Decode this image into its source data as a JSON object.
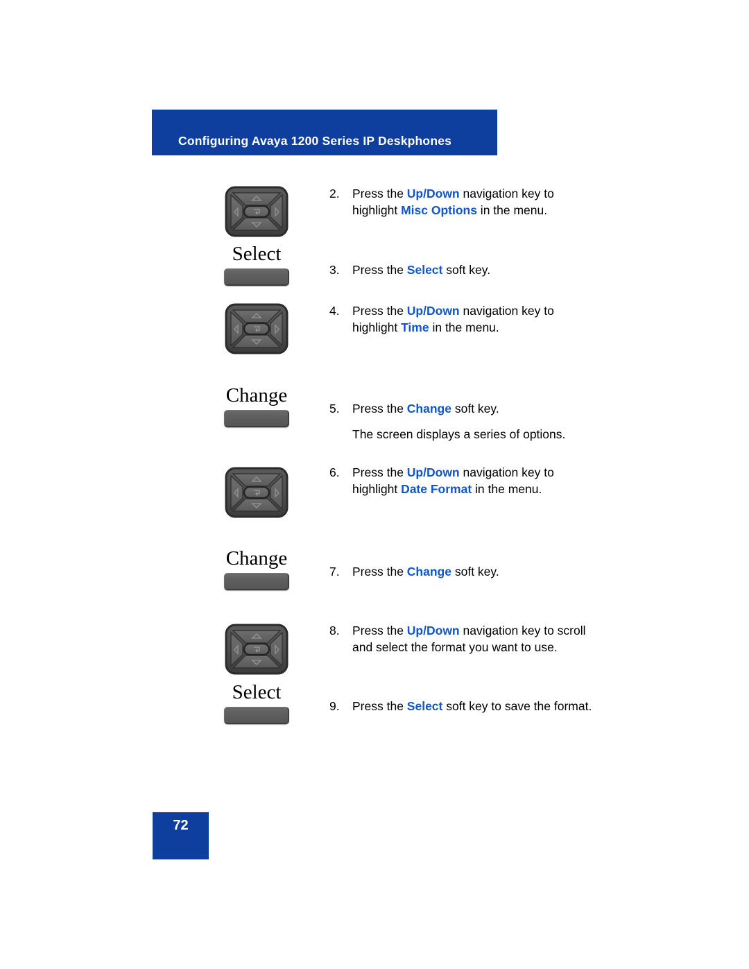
{
  "header": {
    "title": "Configuring Avaya 1200 Series IP Deskphones",
    "banner_color": "#0f3f9e"
  },
  "colors": {
    "banner_blue": "#0f3f9e",
    "emphasis_blue": "#1155cc",
    "key_gray": "#5e5e5e",
    "text_black": "#000000"
  },
  "illustrations": [
    {
      "type": "navigation-key",
      "icon": "navigation-cluster-icon"
    },
    {
      "type": "soft-key",
      "label": "Select",
      "icon": "soft-key-icon"
    },
    {
      "type": "navigation-key",
      "icon": "navigation-cluster-icon"
    },
    {
      "type": "soft-key",
      "label": "Change",
      "icon": "soft-key-icon"
    },
    {
      "type": "navigation-key",
      "icon": "navigation-cluster-icon"
    },
    {
      "type": "soft-key",
      "label": "Change",
      "icon": "soft-key-icon"
    },
    {
      "type": "navigation-key",
      "icon": "navigation-cluster-icon"
    },
    {
      "type": "soft-key",
      "label": "Select",
      "icon": "soft-key-icon"
    }
  ],
  "steps": [
    {
      "number": "2.",
      "segments": [
        {
          "text": "Press the ",
          "emphasis": false
        },
        {
          "text": "Up/Down",
          "emphasis": true
        },
        {
          "text": " navigation key to highlight ",
          "emphasis": false
        },
        {
          "text": "Misc Options",
          "emphasis": true
        },
        {
          "text": " in the menu.",
          "emphasis": false
        }
      ],
      "note": ""
    },
    {
      "number": "3.",
      "segments": [
        {
          "text": "Press the ",
          "emphasis": false
        },
        {
          "text": "Select",
          "emphasis": true
        },
        {
          "text": " soft key.",
          "emphasis": false
        }
      ],
      "note": ""
    },
    {
      "number": "4.",
      "segments": [
        {
          "text": "Press the ",
          "emphasis": false
        },
        {
          "text": "Up/Down",
          "emphasis": true
        },
        {
          "text": " navigation key to highlight ",
          "emphasis": false
        },
        {
          "text": "Time",
          "emphasis": true
        },
        {
          "text": " in the menu.",
          "emphasis": false
        }
      ],
      "note": ""
    },
    {
      "number": "5.",
      "segments": [
        {
          "text": "Press the ",
          "emphasis": false
        },
        {
          "text": "Change",
          "emphasis": true
        },
        {
          "text": " soft key.",
          "emphasis": false
        }
      ],
      "note": "The screen displays a series of options."
    },
    {
      "number": "6.",
      "segments": [
        {
          "text": "Press the ",
          "emphasis": false
        },
        {
          "text": "Up/Down",
          "emphasis": true
        },
        {
          "text": " navigation key to highlight ",
          "emphasis": false
        },
        {
          "text": "Date Format",
          "emphasis": true
        },
        {
          "text": " in the menu.",
          "emphasis": false
        }
      ],
      "note": ""
    },
    {
      "number": "7.",
      "segments": [
        {
          "text": "Press the ",
          "emphasis": false
        },
        {
          "text": "Change",
          "emphasis": true
        },
        {
          "text": " soft key.",
          "emphasis": false
        }
      ],
      "note": ""
    },
    {
      "number": "8.",
      "segments": [
        {
          "text": "Press the ",
          "emphasis": false
        },
        {
          "text": "Up/Down",
          "emphasis": true
        },
        {
          "text": " navigation key to scroll and select the format you want to use.",
          "emphasis": false
        }
      ],
      "note": ""
    },
    {
      "number": "9.",
      "segments": [
        {
          "text": "Press the ",
          "emphasis": false
        },
        {
          "text": "Select",
          "emphasis": true
        },
        {
          "text": " soft key to save the format.",
          "emphasis": false
        }
      ],
      "note": ""
    }
  ],
  "footer": {
    "page_number": "72"
  }
}
